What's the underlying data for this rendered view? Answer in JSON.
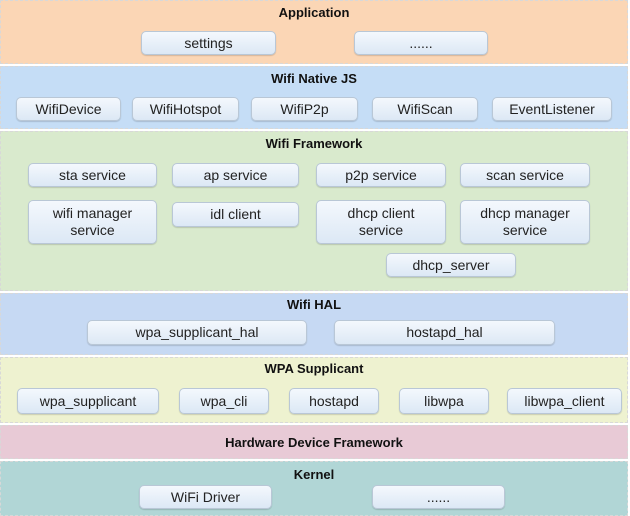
{
  "layers": {
    "application": {
      "title": "Application",
      "color": "#fbd6b5",
      "items": [
        "settings",
        "......"
      ]
    },
    "native_js": {
      "title": "Wifi Native JS",
      "color": "#c5ddf6",
      "items": [
        "WifiDevice",
        "WifiHotspot",
        "WifiP2p",
        "WifiScan",
        "EventListener"
      ]
    },
    "framework": {
      "title": "Wifi Framework",
      "color": "#d9eacd",
      "items": [
        "sta service",
        "ap service",
        "p2p service",
        "scan service",
        "wifi manager service",
        "idl client",
        "dhcp client service",
        "dhcp manager service",
        "dhcp_server"
      ]
    },
    "hal": {
      "title": "Wifi HAL",
      "color": "#c6d9f3",
      "items": [
        "wpa_supplicant_hal",
        "hostapd_hal"
      ]
    },
    "wpa": {
      "title": "WPA Supplicant",
      "color": "#eef2d0",
      "items": [
        "wpa_supplicant",
        "wpa_cli",
        "hostapd",
        "libwpa",
        "libwpa_client"
      ]
    },
    "hardware": {
      "title": "Hardware Device Framework",
      "color": "#e8cad6"
    },
    "kernel": {
      "title": "Kernel",
      "color": "#b1d6d6",
      "items": [
        "WiFi Driver",
        "......"
      ]
    }
  }
}
